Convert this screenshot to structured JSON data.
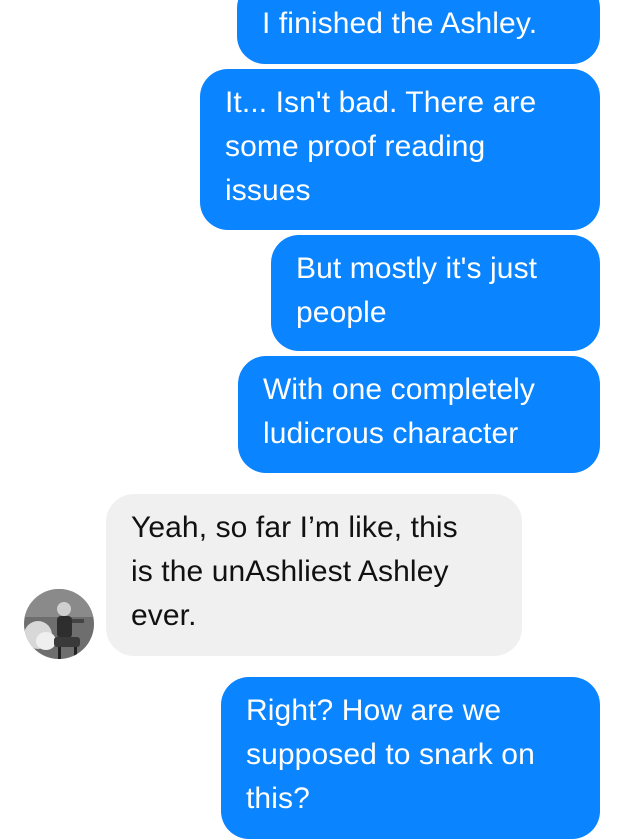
{
  "conversation": {
    "messages": [
      {
        "sender": "me",
        "text": "I finished the Ashley."
      },
      {
        "sender": "me",
        "text": "It... Isn't bad. There are\nsome proof reading\nissues"
      },
      {
        "sender": "me",
        "text": "But mostly it's just\npeople"
      },
      {
        "sender": "me",
        "text": "With one completely\nludicrous character"
      },
      {
        "sender": "other",
        "text": "Yeah, so far I’m like, this\nis the unAshliest Ashley\never."
      },
      {
        "sender": "me",
        "text": "Right? How are we\nsupposed to snark on\nthis?"
      }
    ]
  },
  "colors": {
    "outgoing_bubble": "#0a84ff",
    "incoming_bubble": "#f0f0f0",
    "outgoing_text": "#ffffff",
    "incoming_text": "#111111"
  },
  "icons": {
    "contact_avatar": "contact-avatar-photo"
  }
}
